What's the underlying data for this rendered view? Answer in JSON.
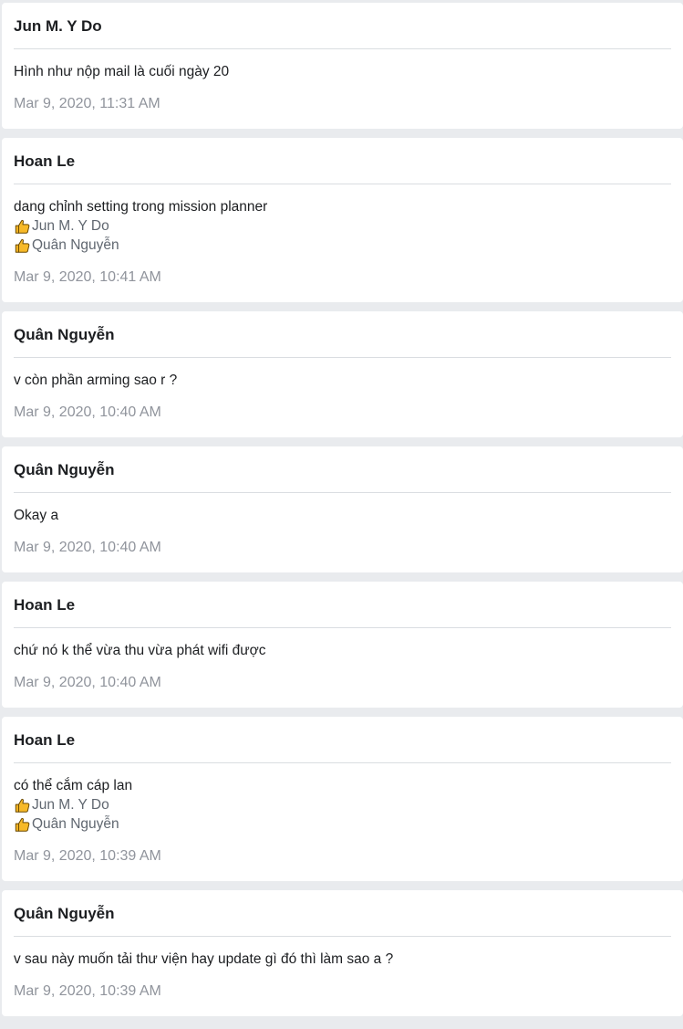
{
  "posts": [
    {
      "author": "Jun M. Y Do",
      "message": "Hình như nộp mail là cuối ngày 20",
      "reactions": [],
      "timestamp": "Mar 9, 2020, 11:31 AM"
    },
    {
      "author": "Hoan Le",
      "message": "dang chỉnh setting trong mission planner",
      "reactions": [
        "Jun M. Y Do",
        "Quân Nguyễn"
      ],
      "timestamp": "Mar 9, 2020, 10:41 AM"
    },
    {
      "author": "Quân Nguyễn",
      "message": "v còn phần arming sao r ?",
      "reactions": [],
      "timestamp": "Mar 9, 2020, 10:40 AM"
    },
    {
      "author": "Quân Nguyễn",
      "message": "Okay a",
      "reactions": [],
      "timestamp": "Mar 9, 2020, 10:40 AM"
    },
    {
      "author": "Hoan Le",
      "message": "chứ nó k thể vừa thu vừa phát wifi được",
      "reactions": [],
      "timestamp": "Mar 9, 2020, 10:40 AM"
    },
    {
      "author": "Hoan Le",
      "message": "có thể cắm cáp lan",
      "reactions": [
        "Jun M. Y Do",
        "Quân Nguyễn"
      ],
      "timestamp": "Mar 9, 2020, 10:39 AM"
    },
    {
      "author": "Quân Nguyễn",
      "message": "v sau này muốn tải thư viện hay update gì đó thì làm sao a ?",
      "reactions": [],
      "timestamp": "Mar 9, 2020, 10:39 AM"
    }
  ],
  "icons": {
    "reaction": "thumbs-up-icon"
  },
  "colors": {
    "background": "#e9ebee",
    "card": "#ffffff",
    "timestamp": "#90949c",
    "reaction_name": "#606770",
    "thumb_fill": "#f7b928"
  }
}
